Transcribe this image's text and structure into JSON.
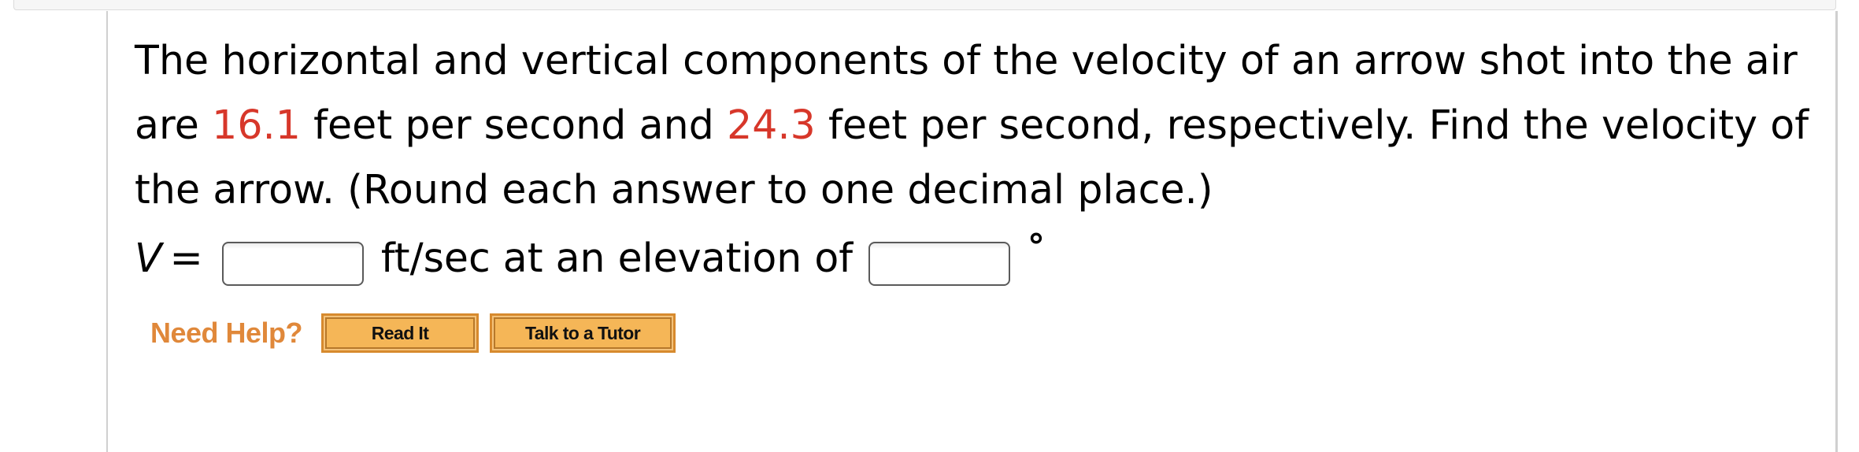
{
  "question": {
    "segments": [
      {
        "text": "The horizontal and vertical components of the velocity of an arrow shot into the air are ",
        "highlight": false
      },
      {
        "text": "16.1",
        "highlight": true
      },
      {
        "text": " feet per second and ",
        "highlight": false
      },
      {
        "text": "24.3",
        "highlight": true
      },
      {
        "text": " feet per second, respectively. Find the velocity of the arrow. (Round each answer to one decimal place.)",
        "highlight": false
      }
    ],
    "highlight_color": "#d7372a"
  },
  "answer": {
    "variable": "V",
    "equals": "=",
    "velocity_value": "",
    "unit_text": "ft/sec at an elevation of",
    "angle_value": "",
    "degree_symbol": "°"
  },
  "help": {
    "label": "Need Help?",
    "buttons": [
      {
        "label": "Read It"
      },
      {
        "label": "Talk to a Tutor"
      }
    ],
    "label_color": "#e0883a",
    "button_color": "#f5b657"
  }
}
